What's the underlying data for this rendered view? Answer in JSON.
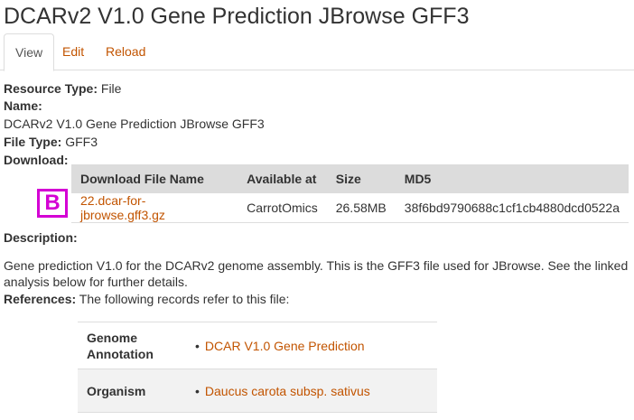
{
  "page_title": "DCARv2 V1.0 Gene Prediction JBrowse GFF3",
  "tabs": [
    {
      "label": "View",
      "active": true
    },
    {
      "label": "Edit",
      "active": false
    },
    {
      "label": "Reload",
      "active": false
    }
  ],
  "fields": {
    "resource_type_label": "Resource Type:",
    "resource_type_value": "File",
    "name_label": "Name:",
    "name_value": "DCARv2 V1.0 Gene Prediction JBrowse GFF3",
    "file_type_label": "File Type:",
    "file_type_value": "GFF3",
    "download_label": "Download:"
  },
  "download_table": {
    "headers": [
      "Download File Name",
      "Available at",
      "Size",
      "MD5"
    ],
    "rows": [
      {
        "file_name": "22.dcar-for-jbrowse.gff3.gz",
        "available_at": "CarrotOmics",
        "size": "26.58MB",
        "md5": "38f6bd9790688c1cf1cb4880dcd0522a"
      }
    ]
  },
  "marker_badge": "B",
  "description": {
    "label": "Description:",
    "text": "Gene prediction V1.0 for the DCARv2 genome assembly. This is the GFF3 file used for JBrowse. See the linked analysis below for further details."
  },
  "references": {
    "label": "References:",
    "intro": "The following records refer to this file:",
    "rows": [
      {
        "type": "Genome Annotation",
        "link": "DCAR V1.0 Gene Prediction"
      },
      {
        "type": "Organism",
        "link": "Daucus carota subsp. sativus"
      }
    ]
  },
  "colors": {
    "link": "#c25400",
    "badge": "#d400d4",
    "table_header_bg": "#dcdcdc"
  }
}
